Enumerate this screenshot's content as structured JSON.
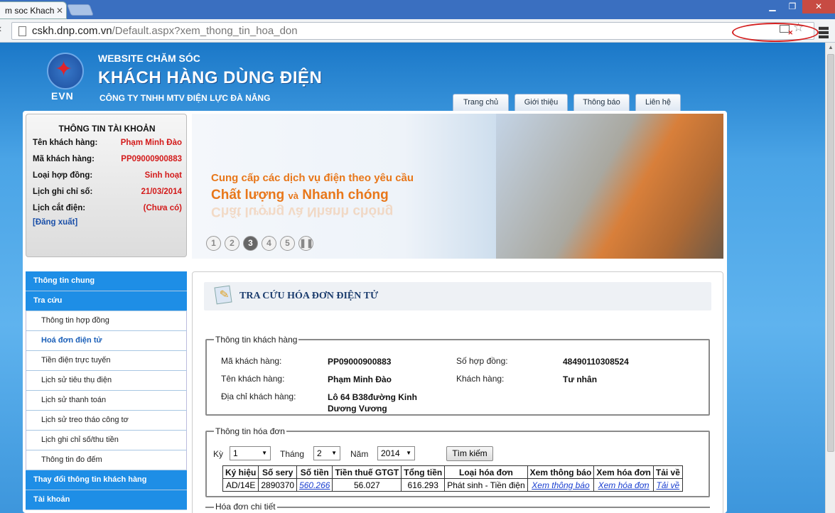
{
  "browser": {
    "tab_title": "m soc Khach",
    "url_host": "cskh.dnp.com.vn",
    "url_path": "/Default.aspx?xem_thong_tin_hoa_don"
  },
  "header": {
    "logo_text": "EVN",
    "line1": "WEBSITE CHĂM SÓC",
    "line2": "KHÁCH HÀNG DÙNG ĐIỆN",
    "line3": "CÔNG TY TNHH MTV ĐIỆN LỰC ĐÀ NẴNG",
    "nav": [
      "Trang chủ",
      "Giới thiệu",
      "Thông báo",
      "Liên hệ"
    ]
  },
  "account": {
    "title": "THÔNG TIN TÀI KHOẢN",
    "rows": [
      {
        "label": "Tên khách hàng:",
        "value": "Phạm Minh Đào"
      },
      {
        "label": "Mã khách hàng:",
        "value": "PP09000900883"
      },
      {
        "label": "Loại hợp đồng:",
        "value": "Sinh hoạt"
      },
      {
        "label": "Lịch ghi chỉ số:",
        "value": "21/03/2014"
      },
      {
        "label": "Lịch cắt điện:",
        "value": "(Chưa có)"
      }
    ],
    "logout": "[Đăng xuất]"
  },
  "banner": {
    "line1": "Cung cấp các dịch vụ điện theo yêu cầu",
    "line2a": "Chất lượng",
    "line2b": "và",
    "line2c": "Nhanh chóng",
    "reflection": "Chất lượng và Nhanh chóng",
    "dots": [
      "1",
      "2",
      "3",
      "4",
      "5",
      "❚❚"
    ]
  },
  "leftnav": {
    "items": [
      {
        "label": "Thông tin chung",
        "kind": "head"
      },
      {
        "label": "Tra cứu",
        "kind": "head"
      },
      {
        "label": "Thông tin hợp đồng",
        "kind": "sub"
      },
      {
        "label": "Hoá đơn điện tử",
        "kind": "sub-active"
      },
      {
        "label": "Tiền điện trực tuyến",
        "kind": "sub"
      },
      {
        "label": "Lịch sử tiêu thụ điện",
        "kind": "sub"
      },
      {
        "label": "Lịch sử thanh toán",
        "kind": "sub"
      },
      {
        "label": "Lịch sử treo tháo công tơ",
        "kind": "sub"
      },
      {
        "label": "Lịch ghi chỉ số/thu tiền",
        "kind": "sub"
      },
      {
        "label": "Thông tin đo đếm",
        "kind": "sub"
      },
      {
        "label": "Thay đổi thông tin khách hàng",
        "kind": "head"
      },
      {
        "label": "Tài khoản",
        "kind": "head"
      }
    ]
  },
  "content": {
    "title": "TRA CỨU HÓA ĐƠN ĐIỆN TỬ",
    "customer": {
      "legend": "Thông tin khách hàng",
      "code_label": "Mã khách hàng:",
      "code": "PP09000900883",
      "contract_label": "Số hợp đồng:",
      "contract": "48490110308524",
      "name_label": "Tên khách hàng:",
      "name": "Phạm Minh Đào",
      "type_label": "Khách hàng:",
      "type": "Tư nhân",
      "address_label": "Địa chỉ khách hàng:",
      "address1": "Lô 64 B38đường Kinh",
      "address2": "Dương Vương"
    },
    "invoice": {
      "legend": "Thông tin hóa đơn",
      "period_label": "Kỳ",
      "period": "1",
      "month_label": "Tháng",
      "month": "2",
      "year_label": "Năm",
      "year": "2014",
      "search": "Tìm kiếm",
      "headers": [
        "Ký hiệu",
        "Số sery",
        "Số tiền",
        "Tiền thuế GTGT",
        "Tổng tiền",
        "Loại hóa đơn",
        "Xem thông báo",
        "Xem hóa đơn",
        "Tải về"
      ],
      "row": [
        "AD/14E",
        "2890370",
        "560.266",
        "56.027",
        "616.293",
        "Phát sinh - Tiền điện",
        "Xem thông báo",
        "Xem hóa đơn",
        "Tải về"
      ]
    },
    "detail_legend": "Hóa đơn chi tiết"
  }
}
